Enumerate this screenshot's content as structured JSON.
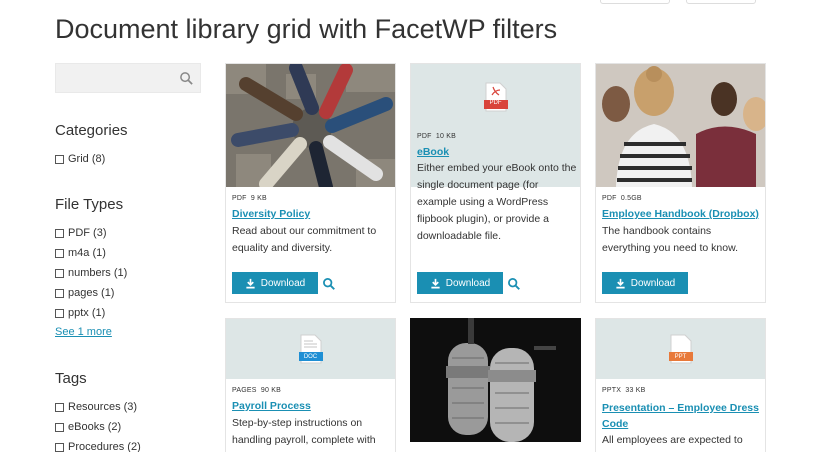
{
  "page": {
    "title": "Document library grid with FacetWP filters"
  },
  "search": {
    "placeholder": ""
  },
  "categories": {
    "title": "Categories",
    "items": [
      {
        "label": "Grid (8)"
      }
    ]
  },
  "file_types": {
    "title": "File Types",
    "items": [
      {
        "label": "PDF (3)"
      },
      {
        "label": "m4a (1)"
      },
      {
        "label": "numbers (1)"
      },
      {
        "label": "pages (1)"
      },
      {
        "label": "pptx (1)"
      }
    ],
    "see_more": "See 1 more"
  },
  "tags": {
    "title": "Tags",
    "items": [
      {
        "label": "Resources (3)"
      },
      {
        "label": "eBooks (2)"
      },
      {
        "label": "Procedures (2)"
      }
    ]
  },
  "cards": [
    {
      "type": "PDF",
      "size": "9 KB",
      "title": "Diversity Policy",
      "desc": "Read about our commitment to equality and diversity.",
      "download": "Download"
    },
    {
      "type": "PDF",
      "size": "10 KB",
      "icon_label": "PDF",
      "title": "eBook",
      "desc": "Either embed your eBook onto the single document page (for example using a WordPress flipbook plugin), or provide a downloadable file.",
      "download": "Download"
    },
    {
      "type": "PDF",
      "size": "0.5GB",
      "title": "Employee Handbook (Dropbox)",
      "desc": "The handbook contains everything you need to know.",
      "download": "Download"
    },
    {
      "type": "PAGES",
      "size": "90 KB",
      "icon_label": "DOC",
      "title": "Payroll Process",
      "desc": "Step-by-step instructions on handling payroll, complete with"
    },
    {
      "type": "PPTX",
      "size": "33 KB",
      "icon_label": "PPT",
      "title": "Presentation – Employee Dress Code",
      "desc": "All employees are expected to look"
    }
  ],
  "colors": {
    "accent": "#1a8fb3",
    "pdf": "#d9443b",
    "doc": "#1f8fd4",
    "ppt": "#e8793a"
  },
  "icons": {
    "search": "search-icon",
    "download": "download-icon",
    "quickview": "magnifier-icon",
    "file": "file-icon"
  }
}
